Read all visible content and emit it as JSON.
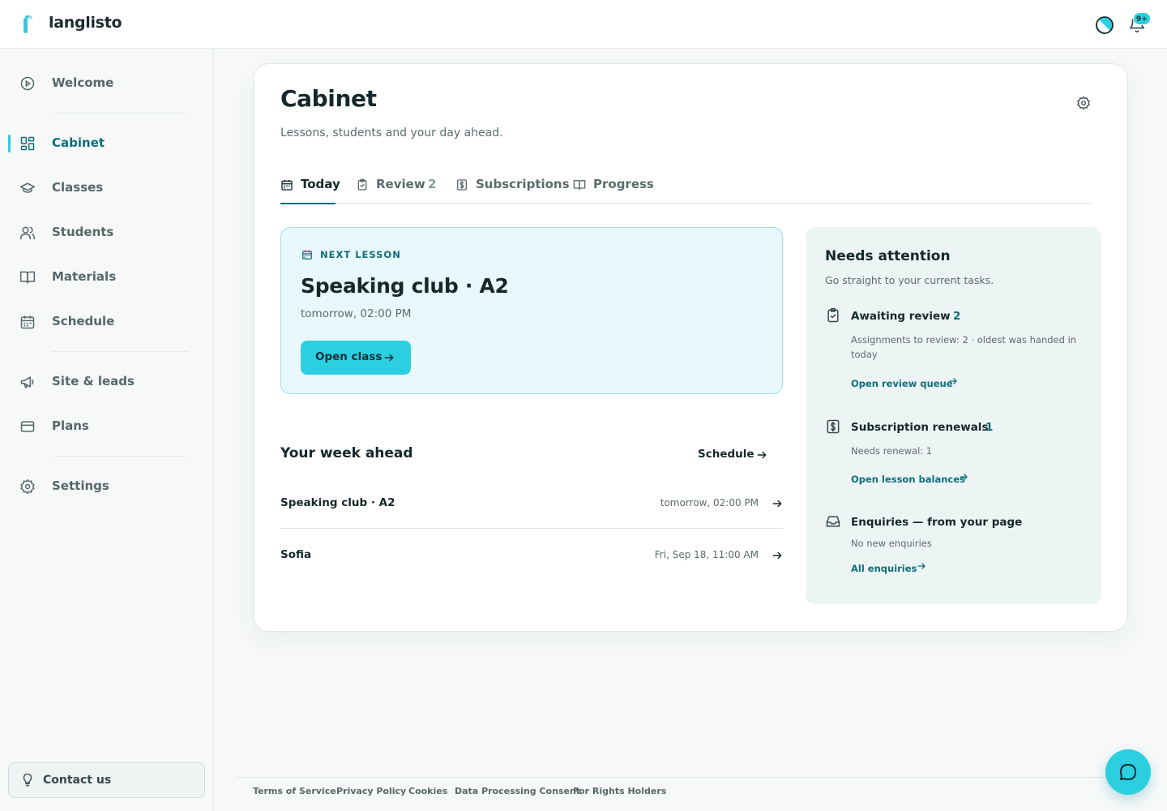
{
  "app": {
    "brand": "langlisto",
    "notifications_badge": "9+"
  },
  "colors": {
    "accent": "#2ccfe0",
    "accent_dark": "#0f6d7a",
    "text": "#15282b",
    "muted": "#5b6b6e"
  },
  "sidebar": {
    "items": [
      {
        "label": "Welcome",
        "icon": "play-circle-icon"
      },
      {
        "label": "Cabinet",
        "icon": "grid-icon",
        "active": true
      },
      {
        "label": "Classes",
        "icon": "graduation-cap-icon"
      },
      {
        "label": "Students",
        "icon": "users-icon"
      },
      {
        "label": "Materials",
        "icon": "book-icon"
      },
      {
        "label": "Schedule",
        "icon": "calendar-icon"
      },
      {
        "label": "Site & leads",
        "icon": "megaphone-icon"
      },
      {
        "label": "Plans",
        "icon": "credit-card-icon"
      },
      {
        "label": "Settings",
        "icon": "gear-icon"
      }
    ],
    "contact_label": "Contact us"
  },
  "main": {
    "title": "Cabinet",
    "subtitle": "Lessons, students and your day ahead.",
    "tabs": [
      {
        "label": "Today",
        "active": true
      },
      {
        "label": "Review",
        "count": "2"
      },
      {
        "label": "Subscriptions"
      },
      {
        "label": "Progress"
      }
    ],
    "next_lesson": {
      "kicker": "NEXT LESSON",
      "title": "Speaking club · A2",
      "time": "tomorrow, 02:00 PM",
      "button": "Open class"
    },
    "week": {
      "title": "Your week ahead",
      "schedule_link": "Schedule",
      "rows": [
        {
          "name": "Speaking club · A2",
          "when": "tomorrow, 02:00 PM"
        },
        {
          "name": "Sofia",
          "when": "Fri, Sep 18, 11:00 AM"
        }
      ]
    },
    "attention": {
      "title": "Needs attention",
      "subtitle": "Go straight to your current tasks.",
      "items": [
        {
          "name": "Awaiting review",
          "count": "2",
          "desc": "Assignments to review: 2 · oldest was handed in today",
          "link": "Open review queue"
        },
        {
          "name": "Subscription renewals",
          "count": "1",
          "desc": "Needs renewal: 1",
          "link": "Open lesson balances"
        },
        {
          "name": "Enquiries — from your page",
          "count": "",
          "desc": "No new enquiries",
          "link": "All enquiries"
        }
      ]
    }
  },
  "footer": {
    "links": [
      "Terms of Service",
      "Privacy Policy",
      "Cookies",
      "Data Processing Consent",
      "For Rights Holders"
    ]
  }
}
